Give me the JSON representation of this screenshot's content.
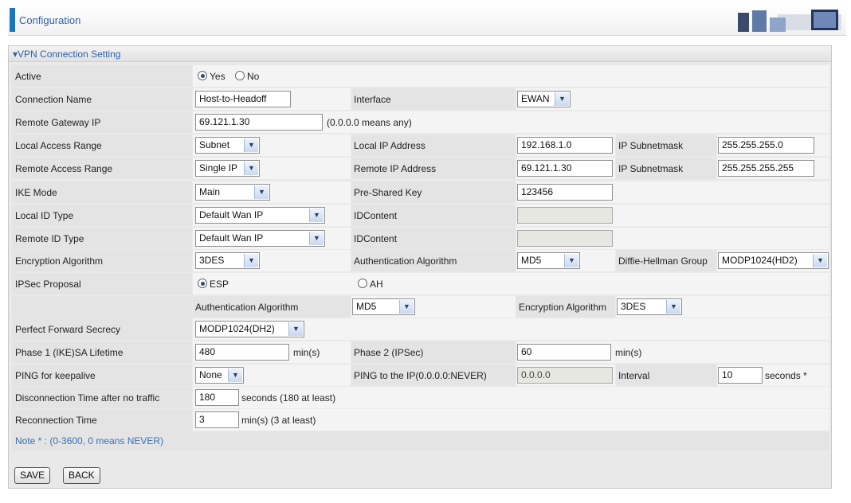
{
  "header": {
    "title": "Configuration"
  },
  "section": {
    "title": "▾VPN Connection Setting"
  },
  "active": {
    "label": "Active",
    "yes": "Yes",
    "no": "No"
  },
  "connection_name": {
    "label": "Connection Name",
    "value": "Host-to-Headoff"
  },
  "interface": {
    "label": "Interface",
    "value": "EWAN"
  },
  "remote_gateway": {
    "label": "Remote Gateway IP",
    "value": "69.121.1.30",
    "hint": "(0.0.0.0 means any)"
  },
  "local_access": {
    "label": "Local Access Range",
    "value": "Subnet",
    "ip_label": "Local IP Address",
    "ip": "192.168.1.0",
    "mask_label": "IP Subnetmask",
    "mask": "255.255.255.0"
  },
  "remote_access": {
    "label": "Remote Access Range",
    "value": "Single IP",
    "ip_label": "Remote IP Address",
    "ip": "69.121.1.30",
    "mask_label": "IP Subnetmask",
    "mask": "255.255.255.255"
  },
  "ike_mode": {
    "label": "IKE Mode",
    "value": "Main",
    "psk_label": "Pre-Shared Key",
    "psk": "123456"
  },
  "local_id": {
    "label": "Local ID Type",
    "value": "Default Wan IP",
    "content_label": "IDContent",
    "content": ""
  },
  "remote_id": {
    "label": "Remote ID Type",
    "value": "Default Wan IP",
    "content_label": "IDContent",
    "content": ""
  },
  "encryption": {
    "label": "Encryption Algorithm",
    "value": "3DES",
    "auth_label": "Authentication Algorithm",
    "auth": "MD5",
    "dh_label": "Diffie-Hellman Group",
    "dh": "MODP1024(HD2)"
  },
  "ipsec": {
    "label": "IPSec Proposal",
    "esp": "ESP",
    "ah": "AH",
    "auth_label": "Authentication Algorithm",
    "auth": "MD5",
    "enc_label": "Encryption Algorithm",
    "enc": "3DES"
  },
  "pfs": {
    "label": "Perfect Forward Secrecy",
    "value": "MODP1024(DH2)"
  },
  "phase": {
    "p1_label": "Phase 1 (IKE)SA Lifetime",
    "p1": "480",
    "p1_unit": "min(s)",
    "p2_label": "Phase 2 (IPSec)",
    "p2": "60",
    "p2_unit": "min(s)"
  },
  "ping": {
    "label": "PING for keepalive",
    "value": "None",
    "ip_label": "PING to the IP(0.0.0.0:NEVER)",
    "ip": "0.0.0.0",
    "interval_label": "Interval",
    "interval": "10",
    "interval_unit": "seconds *"
  },
  "disconnect": {
    "label": "Disconnection Time after no traffic",
    "value": "180",
    "unit": "seconds (180 at least)"
  },
  "reconnect": {
    "label": "Reconnection Time",
    "value": "3",
    "unit": "min(s) (3 at least)"
  },
  "note": "Note * : (0-3600, 0 means NEVER)",
  "buttons": {
    "save": "SAVE",
    "back": "BACK"
  },
  "colors": {
    "accent": "#2d62a8",
    "label_bg": "#e4e4e4",
    "value_bg": "#f4f4f4"
  }
}
